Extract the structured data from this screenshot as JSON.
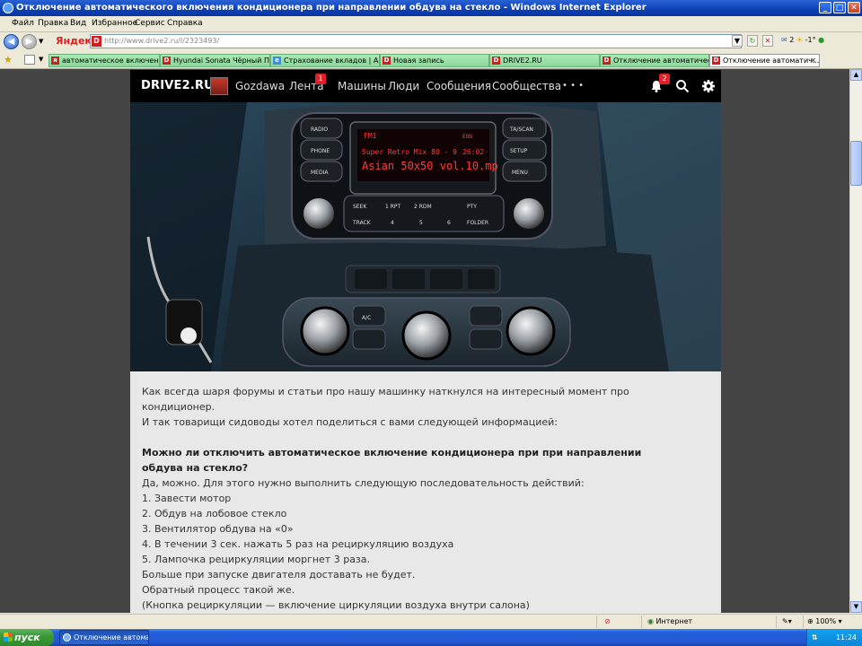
{
  "window": {
    "title": "Отключение автоматического включения кондиционера при направлении обдува на стекло - Windows Internet Explorer"
  },
  "menu": [
    "Файл",
    "Правка",
    "Вид",
    "Избранное",
    "Сервис",
    "Справка"
  ],
  "toolbar": {
    "yandex_label": "Яндекс",
    "url": "http://www.drive2.ru/l/2323493/",
    "mail_count": "2",
    "weather": "-1°"
  },
  "tabs": [
    {
      "label": "автоматическое включени..."
    },
    {
      "label": "Hyundai Sonata Чёрный Пеп..."
    },
    {
      "label": "Страхование вкладов | Аг..."
    },
    {
      "label": "Новая запись"
    },
    {
      "label": "DRIVE2.RU"
    },
    {
      "label": "Отключение автоматическ..."
    },
    {
      "label": "Отключение автоматич..."
    }
  ],
  "site": {
    "logo": "DRIVE2.RU",
    "nav": {
      "user": "Gozdawa",
      "feed": "Лента",
      "feed_badge": "1",
      "cars": "Машины",
      "people": "Люди",
      "messages": "Сообщения",
      "communities": "Сообщества",
      "more": "• • •",
      "notifications_badge": "2"
    }
  },
  "radio": {
    "line1_left": "FM1",
    "line1_right": "EON",
    "line2": "Super Retro Mix 80 - 9",
    "time": "26:02",
    "line3": "Asian 50x50 vol.10.mp",
    "buttons": {
      "radio": "RADIO",
      "phone": "PHONE",
      "media": "MEDIA",
      "tascan": "TA/SCAN",
      "setup": "SETUP",
      "menu": "MENU",
      "seek": "SEEK",
      "track": "TRACK",
      "rpt": "1 RPT",
      "rdm": "2 RDM",
      "pty": "PTY",
      "folder": "FOLDER",
      "n3": "3",
      "n4": "4",
      "n5": "5",
      "n6": "6",
      "ac": "A/C"
    }
  },
  "article": {
    "p1": "Как всегда шаря форумы и статьи про нашу машинку наткнулся на интересный момент про кондиционер.",
    "p2": "И так товарищи сидоводы хотел поделиться с вами следующей информацией:",
    "question": "Можно ли отключить автоматическое включение кондиционера при при направлении обдува на стекло?",
    "answer_intro": "Да, можно. Для этого нужно выполнить следующую последовательность действий:",
    "steps": [
      "1. Завести мотор",
      "2. Обдув на лобовое стекло",
      "3. Вентилятор обдува на «0»",
      "4. В течении 3 сек. нажать 5 раз на рециркуляцию воздуха",
      "5. Лампочка рециркуляции моргнет 3 раза."
    ],
    "after1": "Больше при запуске двигателя доставать не будет.",
    "after2": "Обратный процесс такой же.",
    "after3": "(Кнопка рециркуляции — включение циркуляции воздуха внутри салона)"
  },
  "status": {
    "zone": "Интернет",
    "zoom": "100%"
  },
  "taskbar": {
    "start": "пуск",
    "item": "Отключение автома...",
    "clock": "11:24"
  }
}
